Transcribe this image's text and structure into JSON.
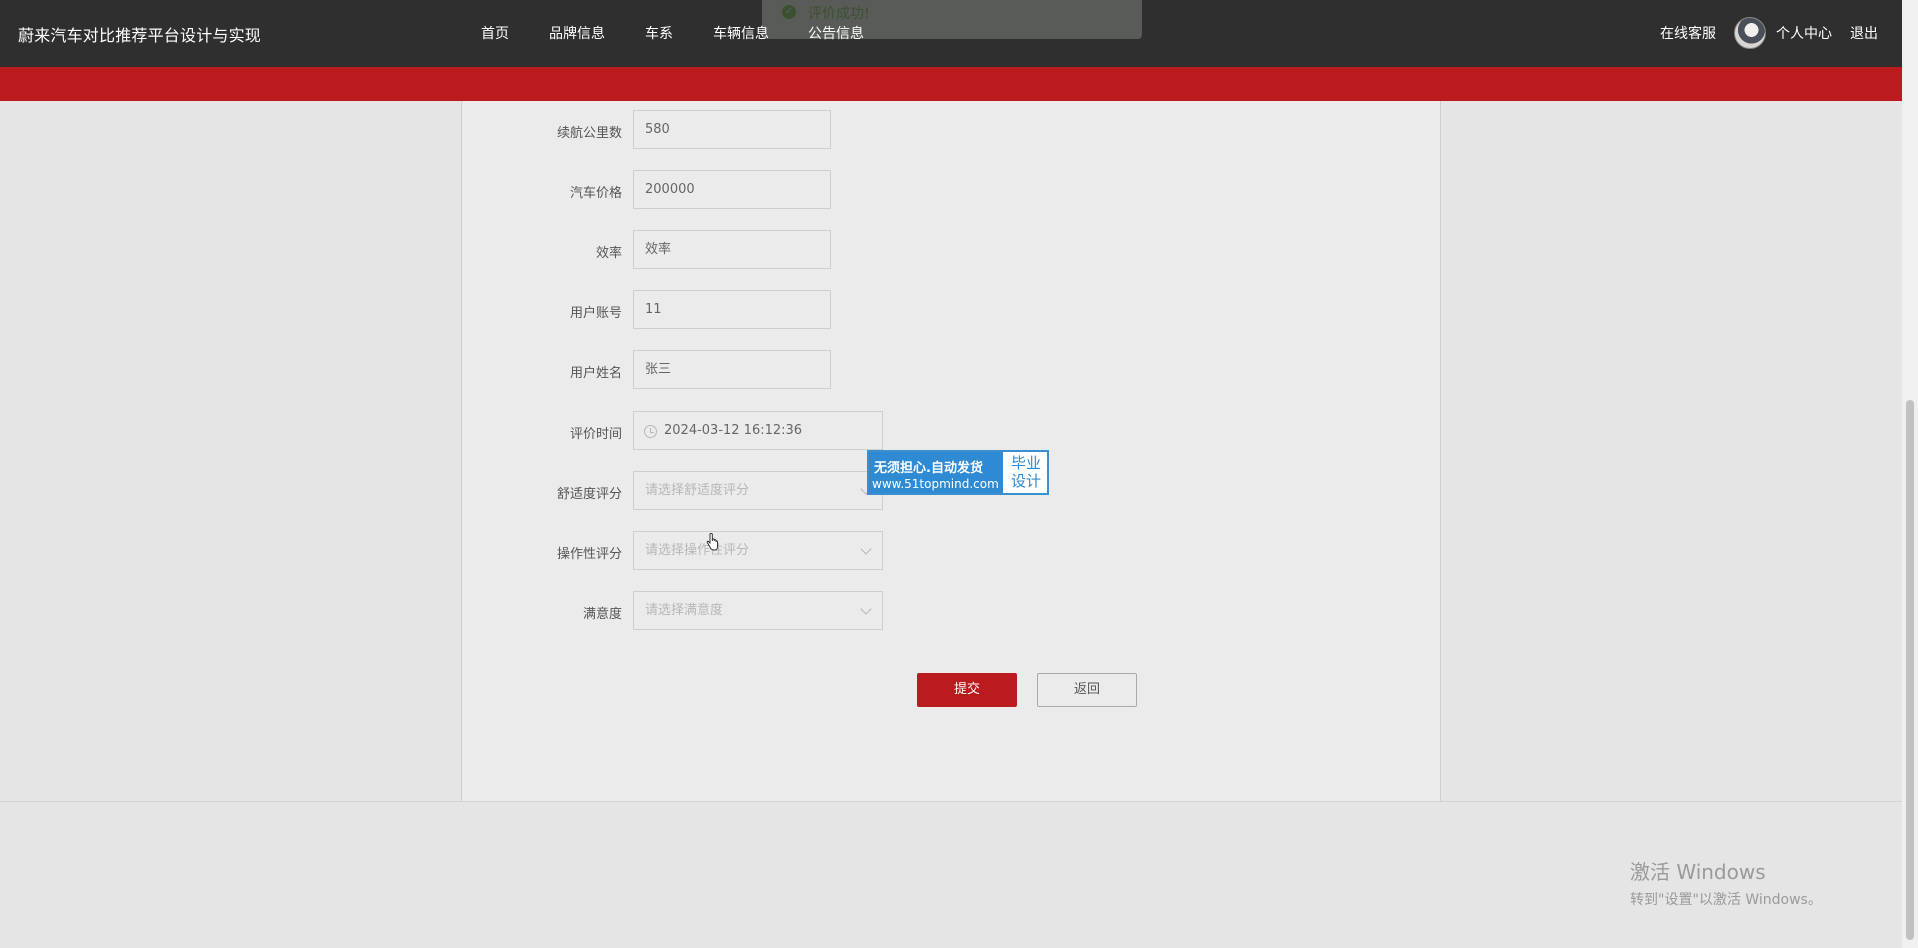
{
  "header": {
    "brand": "蔚来汽车对比推荐平台设计与实现",
    "nav": [
      "首页",
      "品牌信息",
      "车系",
      "车辆信息",
      "公告信息"
    ],
    "right": {
      "service": "在线客服",
      "profile": "个人中心",
      "logout": "退出"
    }
  },
  "toast": {
    "message": "评价成功!"
  },
  "form": {
    "fields": [
      {
        "label": "续航公里数",
        "value": "580"
      },
      {
        "label": "汽车价格",
        "value": "200000"
      },
      {
        "label": "效率",
        "value": "效率"
      },
      {
        "label": "用户账号",
        "value": "11"
      },
      {
        "label": "用户姓名",
        "value": "张三"
      }
    ],
    "datetime": {
      "label": "评价时间",
      "value": "2024-03-12 16:12:36"
    },
    "selects": [
      {
        "label": "舒适度评分",
        "placeholder": "请选择舒适度评分"
      },
      {
        "label": "操作性评分",
        "placeholder": "请选择操作性评分"
      },
      {
        "label": "满意度",
        "placeholder": "请选择满意度"
      }
    ],
    "submit": "提交",
    "back": "返回"
  },
  "ad": {
    "line1": "无须担心.自动发货",
    "line2": "www.51topmind.com",
    "side1": "毕业",
    "side2": "设计"
  },
  "watermark": {
    "line1": "激活 Windows",
    "line2": "转到\"设置\"以激活 Windows。"
  },
  "colors": {
    "header_bg": "#2f2f2f",
    "accent_red": "#bb1a1e",
    "panel_bg": "#ebebeb"
  }
}
